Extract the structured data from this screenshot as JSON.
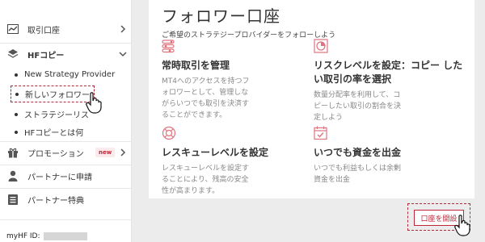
{
  "sidebar": {
    "items": [
      {
        "label": "取引口座",
        "icon": "chart-line-icon"
      },
      {
        "label": "HFコピー",
        "icon": "layers-icon"
      },
      {
        "label": "プロモーション",
        "icon": "gift-icon",
        "badge": "new"
      },
      {
        "label": "パートナーに申請",
        "icon": "user-icon"
      },
      {
        "label": "パートナー特典",
        "icon": "list-icon"
      }
    ],
    "sub_items": [
      "New Strategy Provider",
      "新しいフォロワー",
      "ストラテジーリス",
      "HFコピーとは何"
    ],
    "myhf_label": "myHF ID:"
  },
  "main": {
    "title": "フォロワー口座",
    "subtitle": "ご希望のストラテジープロバイダーをフォローしよう",
    "features": [
      {
        "title": "常時取引を管理",
        "desc": [
          "MT4へのアクセスを持つフ",
          "ォロワーとして、管理しな",
          "がらいつでも取引を決済す",
          "ることができます。"
        ],
        "icon": "sliders-icon"
      },
      {
        "title": "リスクレベルを設定：コピー したい取引の率を選択",
        "desc": [
          "数量分配率を利用して、コ",
          "ピーしたい取引の割合を決",
          "定しよう"
        ],
        "icon": "pie-chart-icon"
      },
      {
        "title": "レスキューレベルを設定",
        "desc": [
          "レスキューレベルを設定す",
          "ることにより、残高の安全",
          "性が高まります。"
        ],
        "icon": "lifebuoy-icon"
      },
      {
        "title": "いつでも資金を出金",
        "desc": [
          "いつでも利益もしくは余剰",
          "資金を出金"
        ],
        "icon": "calendar-icon"
      }
    ],
    "open_button": "口座を開設"
  },
  "colors": {
    "accent": "#c0283a",
    "highlight_border": "#b02a3a"
  }
}
